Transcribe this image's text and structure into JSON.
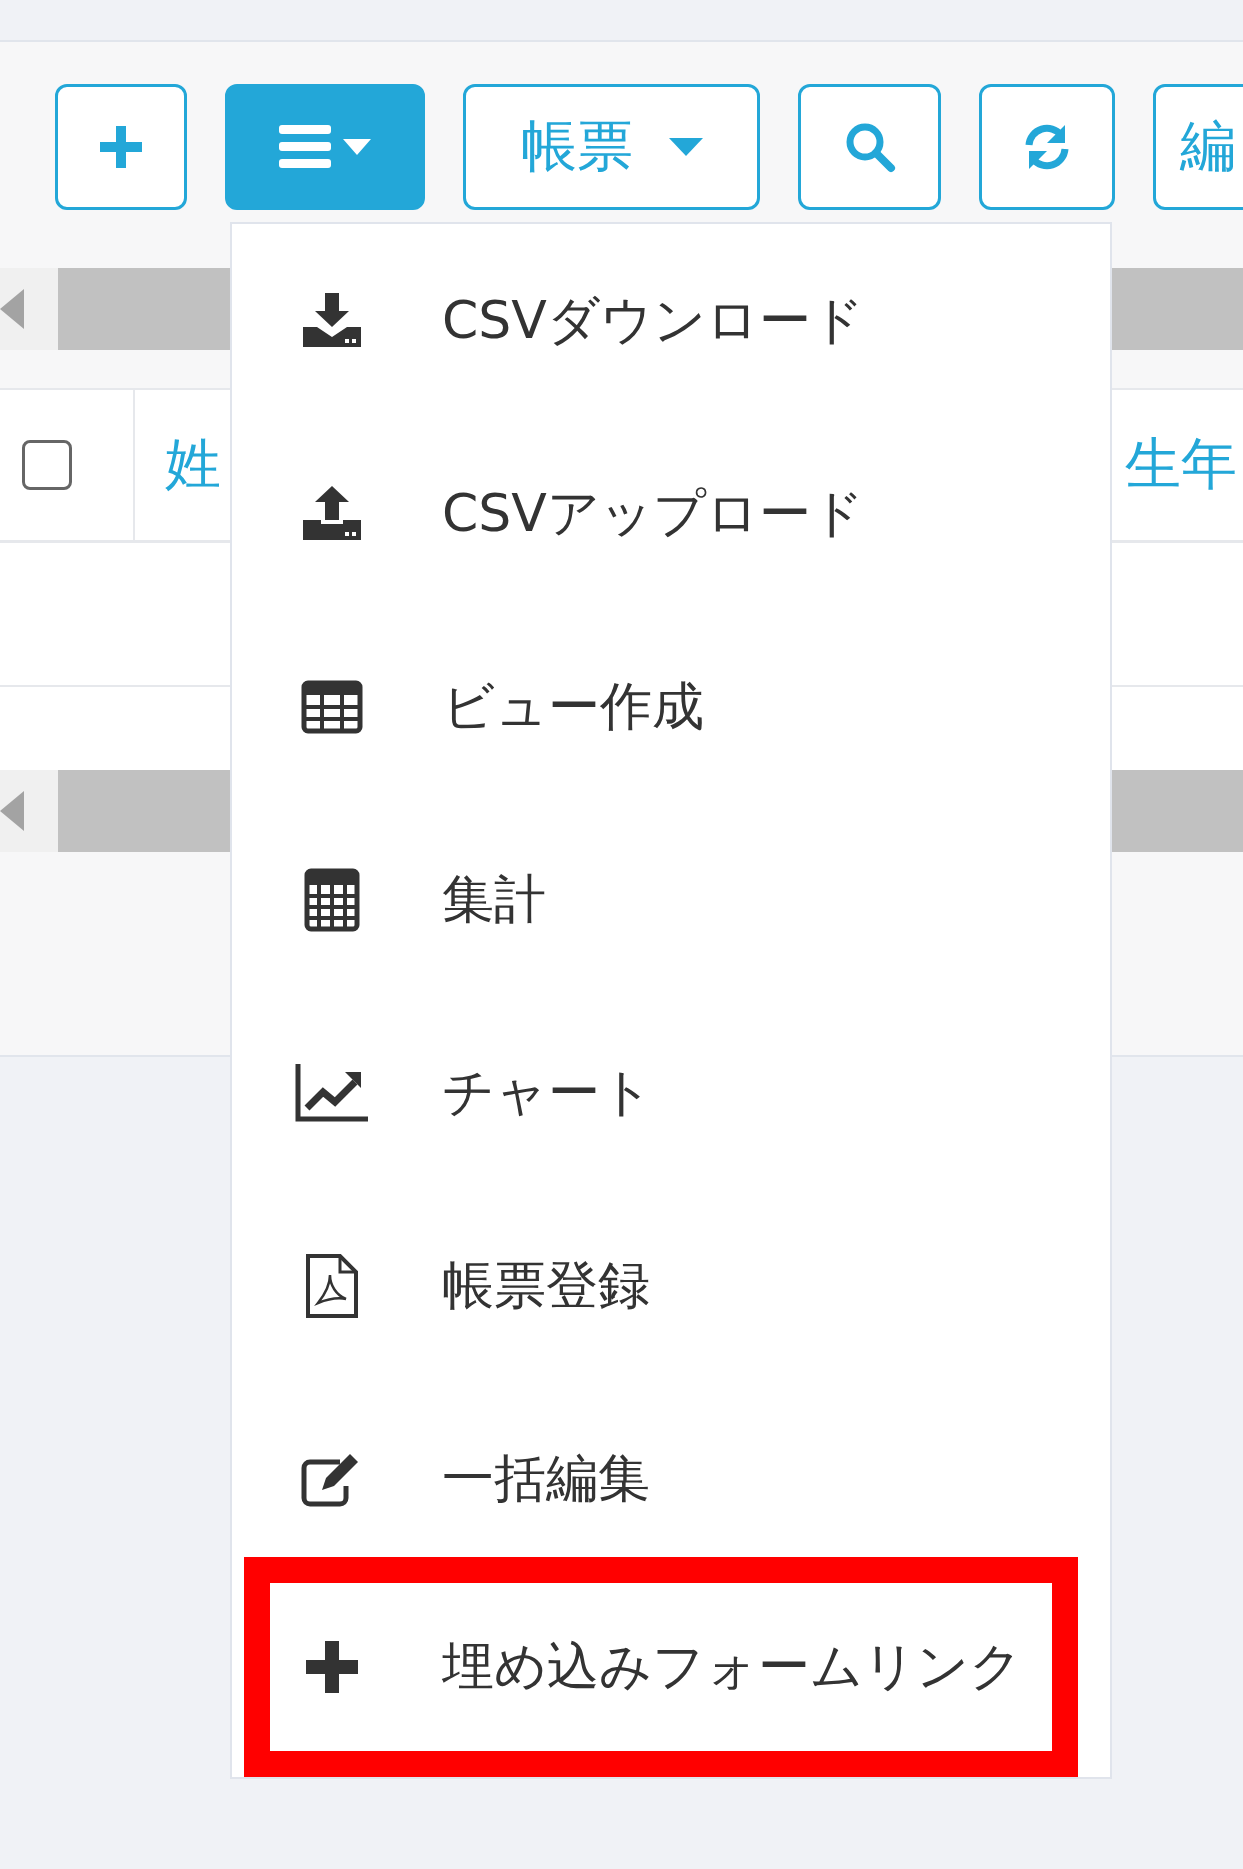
{
  "toolbar": {
    "buttons": [
      {
        "kind": "add",
        "active": false
      },
      {
        "kind": "menu",
        "active": true
      },
      {
        "kind": "report",
        "label": "帳票",
        "active": false
      },
      {
        "kind": "search",
        "active": false
      },
      {
        "kind": "refresh",
        "active": false
      },
      {
        "kind": "text",
        "label": "編",
        "active": false
      }
    ]
  },
  "table": {
    "select_all": {
      "checked": false
    },
    "columns": [
      "姓",
      "生年"
    ]
  },
  "menu": {
    "items": [
      {
        "kind": "download",
        "label": "CSVダウンロード",
        "highlighted": false
      },
      {
        "kind": "upload",
        "label": "CSVアップロード",
        "highlighted": false
      },
      {
        "kind": "table",
        "label": "ビュー作成",
        "highlighted": false
      },
      {
        "kind": "calculator",
        "label": "集計",
        "highlighted": false
      },
      {
        "kind": "chart",
        "label": "チャート",
        "highlighted": false
      },
      {
        "kind": "pdf",
        "label": "帳票登録",
        "highlighted": false
      },
      {
        "kind": "edit",
        "label": "一括編集",
        "highlighted": false
      },
      {
        "kind": "plus",
        "label": "埋め込みフォームリンク",
        "highlighted": true
      }
    ]
  }
}
